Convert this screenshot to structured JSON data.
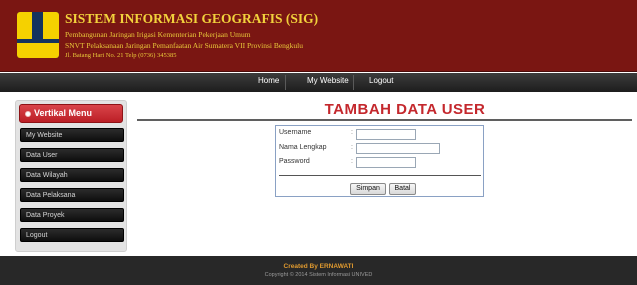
{
  "header": {
    "title": "SISTEM INFORMASI GEOGRAFIS (SIG)",
    "line1": "Pembangunan Jaringan Irigasi Kementerian Pekerjaan Umum",
    "line2": "SNVT Pelaksanaan Jaringan Pemanfaatan Air Sumatera VII Provinsi Bengkulu",
    "line3": "Jl. Batang Hari No. 21 Telp (0736) 345385",
    "logo": "kementerian-pu-logo"
  },
  "nav": {
    "items": [
      "Home",
      "My Website",
      "Logout"
    ]
  },
  "sidebar": {
    "title": "Vertikal Menu",
    "items": [
      "My Website",
      "Data User",
      "Data Wilayah",
      "Data Pelaksana",
      "Data Proyek",
      "Logout"
    ]
  },
  "main": {
    "title": "TAMBAH DATA USER",
    "form": {
      "fields": [
        {
          "label": "Username",
          "colon": ":",
          "value": ""
        },
        {
          "label": "Nama Lengkap",
          "colon": ":",
          "value": ""
        },
        {
          "label": "Password",
          "colon": ":",
          "value": ""
        }
      ],
      "save_label": "Simpan",
      "cancel_label": "Batal"
    }
  },
  "footer": {
    "credit": "Created By ERNAWATI",
    "copyright": "Copyright © 2014 Sistem Informasi UNIVED"
  },
  "colors": {
    "header_bg": "#7a1612",
    "title_gold": "#f2d23c",
    "accent_red": "#c4282d",
    "nav_bg": "#2a2a2a",
    "footer_bg": "#282828"
  }
}
